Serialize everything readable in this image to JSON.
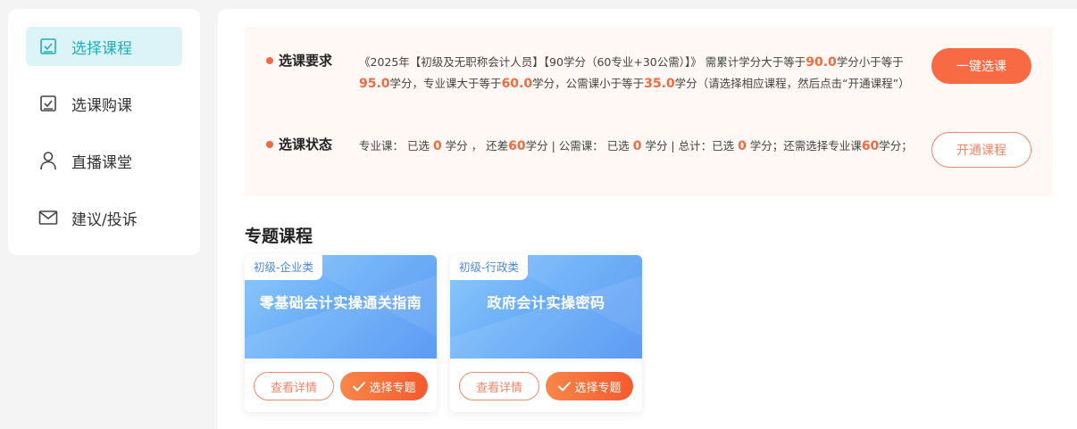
{
  "sidebar": {
    "items": [
      {
        "label": "选择课程",
        "icon": "checklist-icon",
        "active": true
      },
      {
        "label": "选课购课",
        "icon": "checklist-icon",
        "active": false
      },
      {
        "label": "直播课堂",
        "icon": "user-icon",
        "active": false
      },
      {
        "label": "建议/投诉",
        "icon": "mail-icon",
        "active": false
      }
    ]
  },
  "requirements": {
    "title": "选课要求",
    "text_1": "《2025年【初级及无职称会计人员】【90学分（60专业+30公需）】》 需累计学分大于等于",
    "val_1": "90.0",
    "text_2": "学分小于等于",
    "val_2": "95.0",
    "text_3": "学分，专业课大于等于",
    "val_3": "60.0",
    "text_4": "学分，公需课小于等于",
    "val_4": "35.0",
    "text_5": "学分（请选择相应课程，然后点击“开通课程”）",
    "button": "一键选课"
  },
  "status": {
    "title": "选课状态",
    "t1": "专业课：  已选 ",
    "v1": "0",
    "t2": " 学分 ，  还差",
    "v2": "60",
    "t3": "学分 | 公需课：  已选 ",
    "v3": "0",
    "t4": " 学分 | 总计：已选 ",
    "v4": "0",
    "t5": " 学分；还需选择专业课",
    "v5": "60",
    "t6": "学分；",
    "button": "开通课程"
  },
  "section_title": "专题课程",
  "courses": [
    {
      "tag": "初级-企业类",
      "title": "零基础会计实操通关指南",
      "detail_label": "查看详情",
      "select_label": "选择专题"
    },
    {
      "tag": "初级-行政类",
      "title": "政府会计实操密码",
      "detail_label": "查看详情",
      "select_label": "选择专题"
    }
  ],
  "colors": {
    "accent": "#f76a44",
    "teal": "#1faebe",
    "card_blue": "#4a90f2"
  }
}
